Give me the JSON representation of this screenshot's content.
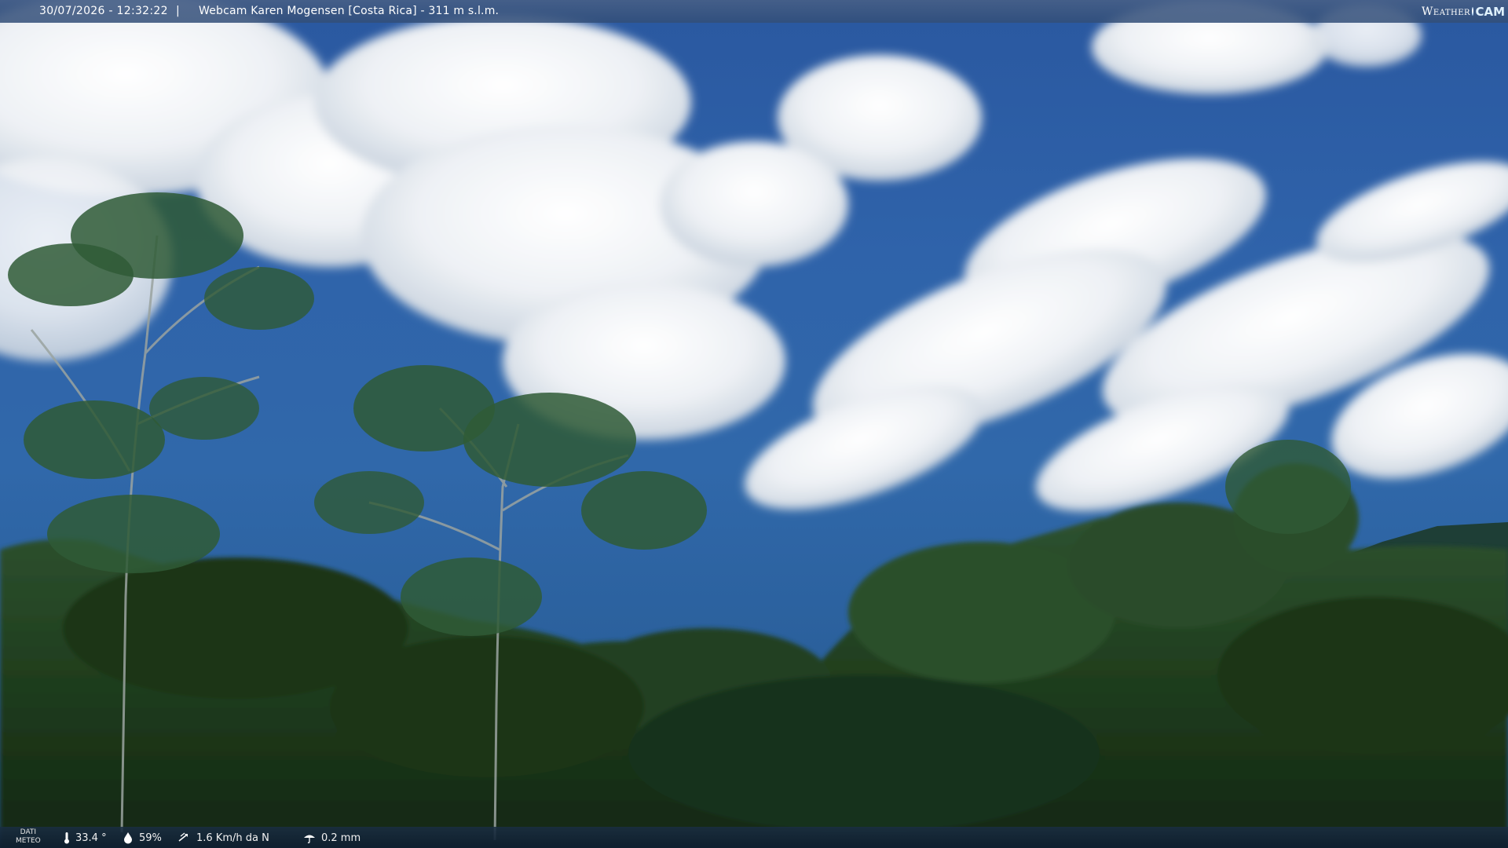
{
  "overlay": {
    "timestamp": "30/07/2026 - 12:32:22",
    "separator": "|",
    "title": "Webcam Karen Mogensen [Costa Rica] - 311 m s.l.m.",
    "logo_weather": "Weather",
    "logo_cam": "CAM"
  },
  "weather": {
    "label_line1": "DATI",
    "label_line2": "METEO",
    "temperature": "33.4 °",
    "humidity": "59%",
    "wind": "1.6 Km/h da N",
    "rain": "0.2 mm"
  },
  "icons": {
    "temperature": "thermometer-icon",
    "humidity": "humidity-drop-icon",
    "wind": "wind-icon",
    "rain": "rain-icon"
  },
  "colors": {
    "sky": "#2f63aa",
    "foliage": "#1f3d1c",
    "bar": "#1a2e42"
  }
}
